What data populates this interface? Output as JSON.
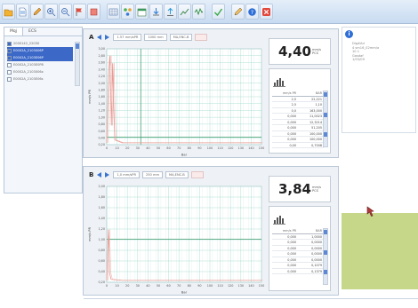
{
  "toolbar": {
    "buttons": [
      {
        "icon": "folder-icon"
      },
      {
        "icon": "document-icon"
      },
      {
        "icon": "edit-icon"
      },
      {
        "icon": "zoom-in-icon"
      },
      {
        "icon": "zoom-out-icon"
      },
      {
        "icon": "flag-icon"
      },
      {
        "icon": "delete-icon"
      },
      {
        "icon": "table-icon"
      },
      {
        "icon": "network-icon"
      },
      {
        "icon": "calendar-icon"
      },
      {
        "icon": "download-icon"
      },
      {
        "icon": "upload-icon"
      },
      {
        "icon": "chart-icon"
      },
      {
        "icon": "signal-icon"
      },
      {
        "icon": "check-icon"
      },
      {
        "icon": "edit-tool-icon"
      },
      {
        "icon": "help-icon"
      },
      {
        "icon": "close-icon"
      }
    ]
  },
  "left_panel": {
    "tabs": [
      "Mqj",
      "ECS"
    ],
    "tree": [
      {
        "label": "2000142_22030",
        "checked": true,
        "selected": false
      },
      {
        "label": "E0002A_2103006P",
        "checked": true,
        "selected": true
      },
      {
        "label": "E0002A_2103E06P",
        "checked": true,
        "selected": true
      },
      {
        "label": "E0002A_2103E0P8",
        "checked": false,
        "selected": false
      },
      {
        "label": "E0002A_2103006x",
        "checked": false,
        "selected": false
      },
      {
        "label": "E0002A_2103E06s",
        "checked": false,
        "selected": false
      }
    ]
  },
  "charts": [
    {
      "letter": "A",
      "field1": "1.57 mm/sPR",
      "field2": "1000 mm",
      "field3": "MA,ENC-B",
      "reading_value": "4,40",
      "reading_unit": [
        "mm/s",
        "PCS"
      ],
      "table_header": [
        "mm/s PR",
        "BAR"
      ],
      "table_rows": [
        [
          "2,5",
          "22,221"
        ],
        [
          "2,5",
          "1,10"
        ],
        [
          "0,0",
          "163,000"
        ],
        [
          "0,000",
          "11,0023"
        ],
        [
          "0,000",
          "12,3214"
        ],
        [
          "0,000",
          "51,205"
        ],
        [
          "0,000",
          "100,000"
        ],
        [
          "0,000",
          "100,000"
        ],
        [
          "0,00",
          "0,7008"
        ]
      ],
      "y_ticks": [
        "3,00",
        "2,80",
        "2,60",
        "2,40",
        "2,20",
        "2,00",
        "1,80",
        "1,60",
        "1,40",
        "1,20",
        "1,00",
        "0,80",
        "0,60",
        "0,40",
        "0,20"
      ],
      "x_ticks": [
        "0",
        "10",
        "20",
        "30",
        "40",
        "50",
        "60",
        "70",
        "80",
        "90",
        "100",
        "110",
        "120",
        "130",
        "140",
        "150"
      ],
      "y_label": "mm/s PR",
      "x_label": "Bar"
    },
    {
      "letter": "B",
      "field1": "1,0 mm/sPR",
      "field2": "250 mm",
      "field3": "MA,ENC-B",
      "reading_value": "3,84",
      "reading_unit": [
        "mm/s",
        "PCS"
      ],
      "table_header": [
        "mm/s PR",
        "BAR"
      ],
      "table_rows": [
        [
          "0,000",
          "1,0000"
        ],
        [
          "0,000",
          "0,0000"
        ],
        [
          "0,000",
          "0,0000"
        ],
        [
          "0,000",
          "0,0000"
        ],
        [
          "0,000",
          "0,0000"
        ],
        [
          "0,000",
          "0,1079"
        ],
        [
          "0,000",
          "0,1379"
        ]
      ],
      "y_ticks": [
        "2,00",
        "1,80",
        "1,60",
        "1,40",
        "1,20",
        "1,00",
        "0,80",
        "0,60",
        "0,40",
        "0,20"
      ],
      "x_ticks": [
        "0",
        "10",
        "20",
        "30",
        "40",
        "50",
        "60",
        "70",
        "80",
        "90",
        "100",
        "110",
        "120",
        "130",
        "140",
        "150"
      ],
      "y_label": "mm/s PR",
      "x_label": "Bar"
    }
  ],
  "info_panel": {
    "lines": [
      "Dlg#Ad",
      "4 sm16_02mm/a",
      "10 1",
      "Gasdaf",
      "1/03/09"
    ]
  },
  "colors": {
    "grid": "#8fd2c4",
    "trace": "#e89a94",
    "limit_line": "#3c9a6c",
    "accent": "#3a72d0",
    "green_panel": "#c6d789"
  }
}
